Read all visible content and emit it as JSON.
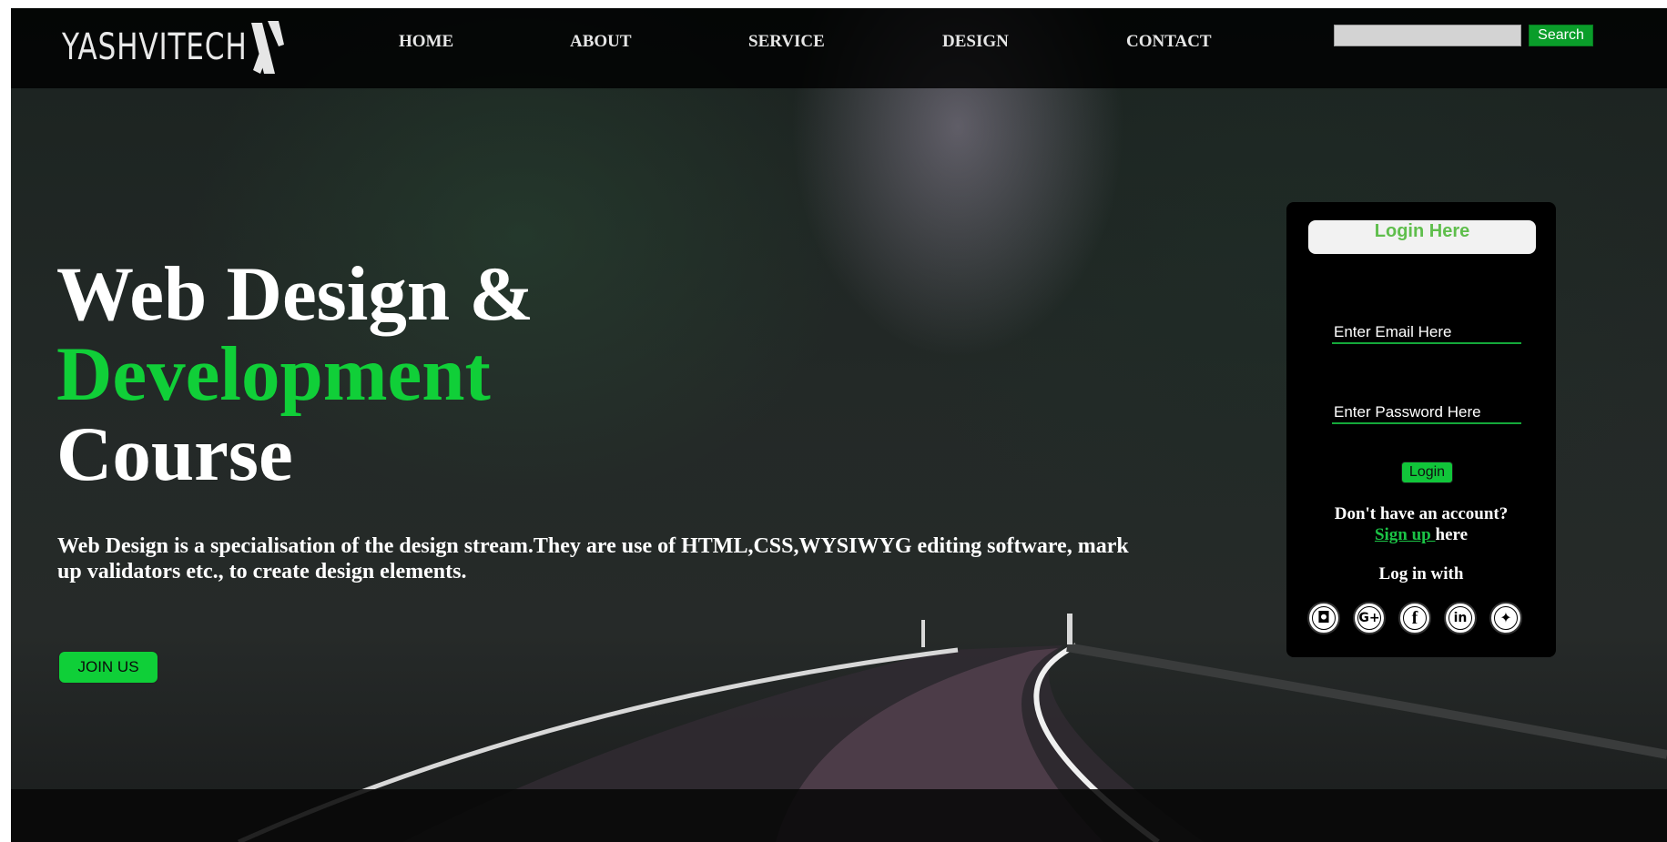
{
  "brand": {
    "name": "YASHVITECH"
  },
  "nav": {
    "items": [
      "HOME",
      "ABOUT",
      "SERVICE",
      "DESIGN",
      "CONTACT"
    ]
  },
  "search": {
    "button_label": "Search",
    "placeholder": ""
  },
  "hero": {
    "line1": "Web Design &",
    "line2": "Development",
    "line3": "Course",
    "description": "Web Design is a specialisation of the design stream.They are use of HTML,CSS,WYSIWYG editing software, mark up validators etc., to create design elements.",
    "join_label": "JOIN US"
  },
  "login": {
    "heading": "Login Here",
    "email_placeholder": "Enter Email Here",
    "password_placeholder": "Enter Password Here",
    "button_label": "Login",
    "no_account": "Don't have an account?",
    "signup_link": "Sign up ",
    "signup_suffix": "here",
    "login_with": "Log in with",
    "social": [
      "instagram",
      "google-plus",
      "facebook",
      "linkedin",
      "twitter"
    ]
  },
  "colors": {
    "accent": "#10cf38",
    "search_button": "#0a9d2a",
    "login_heading": "#5fbe4c"
  }
}
